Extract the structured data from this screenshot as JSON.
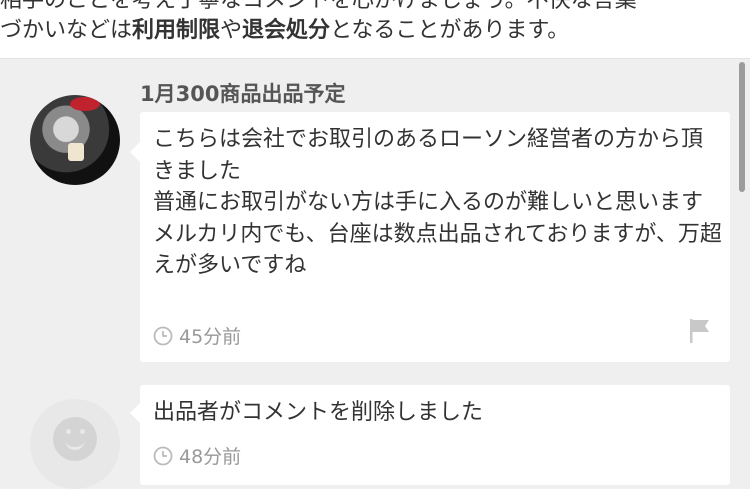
{
  "notice": {
    "line1": "相手のことを考え丁寧なコメントを心がけましょう。不快な言葉",
    "line2_pre": "づかいなどは",
    "line2_b1": "利用制限",
    "line2_mid": "や",
    "line2_b2": "退会処分",
    "line2_post": "となることがあります。"
  },
  "comments": [
    {
      "seller_name": "1月300商品出品予定",
      "text": "こちらは会社でお取引のあるローソン経営者の方から頂きました\n普通にお取引がない方は手に入るのが難しいと思います\nメルカリ内でも、台座は数点出品されておりますが、万超えが多いですね",
      "time": "45分前"
    },
    {
      "text": "出品者がコメントを削除しました",
      "time": "48分前"
    }
  ],
  "icons": [
    "clock-icon",
    "flag-icon",
    "default-avatar-icon"
  ]
}
